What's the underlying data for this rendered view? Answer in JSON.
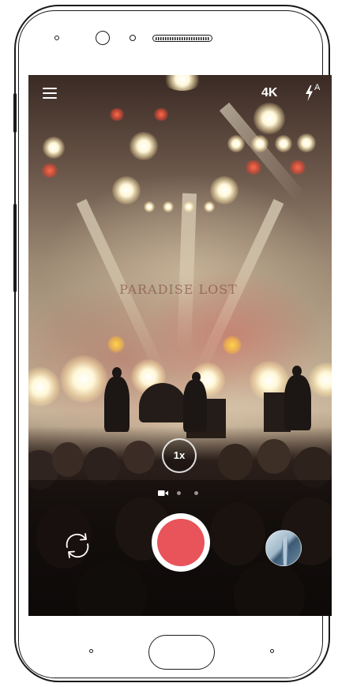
{
  "top_bar": {
    "menu_icon": "hamburger-menu-icon",
    "resolution_label": "4K",
    "flash_icon": "flash-auto-icon",
    "flash_mode_label": "A"
  },
  "viewfinder": {
    "scene": "concert-stage-photo",
    "band_backdrop_text": "PARADISE LOST",
    "zoom_label": "1x"
  },
  "mode_selector": {
    "active_mode_icon": "video-camera-icon",
    "dots": 3,
    "active_index": 0
  },
  "bottom_controls": {
    "switch_camera_icon": "switch-camera-icon",
    "shutter_color": "#e8545a",
    "gallery_icon": "gallery-thumbnail"
  },
  "colors": {
    "accent": "#e8545a",
    "overlay_text": "#ffffff"
  }
}
